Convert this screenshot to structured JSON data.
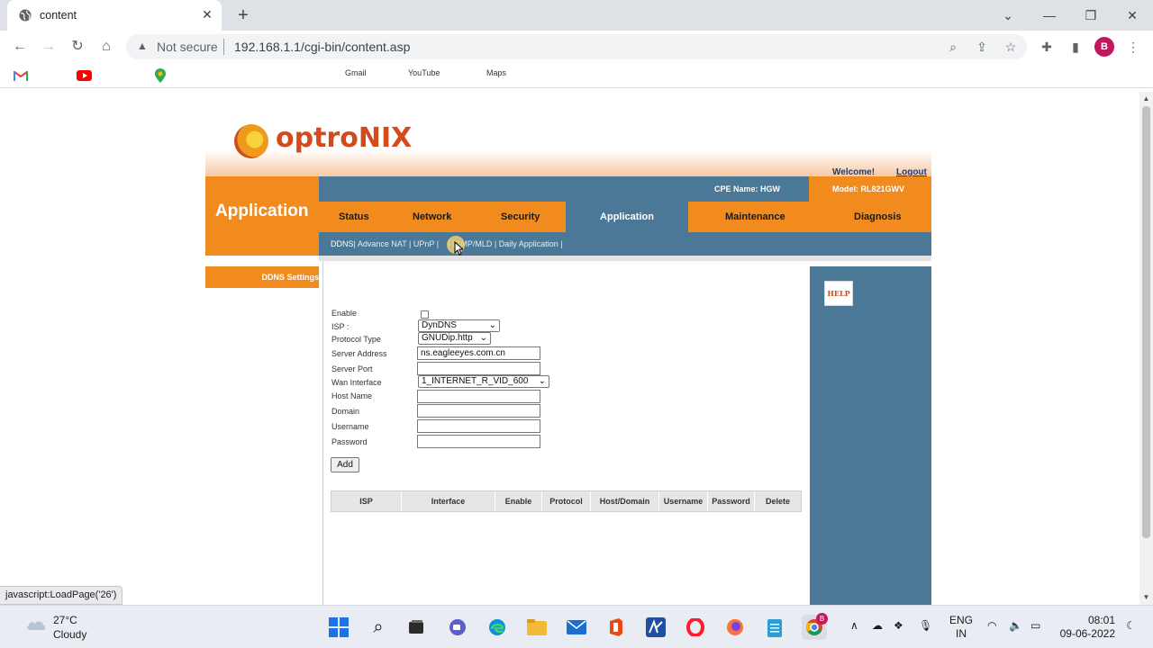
{
  "browser": {
    "tab_title": "content",
    "address": {
      "security_label": "Not secure",
      "url": "192.168.1.1/cgi-bin/content.asp"
    },
    "bookmarks": [
      {
        "label": "Gmail",
        "icon": "gmail-icon"
      },
      {
        "label": "YouTube",
        "icon": "youtube-icon"
      },
      {
        "label": "Maps",
        "icon": "maps-icon"
      }
    ],
    "profile_initial": "B",
    "status_url": "javascript:LoadPage('26')"
  },
  "router": {
    "brand": "optroNIX",
    "welcome": "Welcome!",
    "logout": "Logout",
    "section_title": "Application",
    "cpe_name": "CPE Name: HGW",
    "model": "Model: RL821GWV",
    "menu": [
      "Status",
      "Network",
      "Security",
      "Application",
      "Maintenance",
      "Diagnosis"
    ],
    "active_menu": "Application",
    "submenu": {
      "active": "DDNS",
      "rest": "| Advance NAT | UPnP |    | IGMP/MLD | Daily Application |"
    },
    "side_tab": "DDNS Settings",
    "help_label": "HELP",
    "form": {
      "enable_label": "Enable",
      "isp_label": "ISP :",
      "isp_value": "DynDNS",
      "protocol_label": "Protocol Type",
      "protocol_value": "GNUDip.http",
      "server_address_label": "Server Address",
      "server_address_value": "ns.eagleeyes.com.cn",
      "server_port_label": "Server Port",
      "server_port_value": "",
      "wan_label": "Wan Interface",
      "wan_value": "1_INTERNET_R_VID_600",
      "host_label": "Host Name",
      "host_value": "",
      "domain_label": "Domain",
      "domain_value": "",
      "username_label": "Username",
      "username_value": "",
      "password_label": "Password",
      "password_value": "",
      "add_button": "Add"
    },
    "table_headers": [
      "ISP",
      "Interface",
      "Enable",
      "Protocol",
      "Host/Domain",
      "Username",
      "Password",
      "Delete"
    ]
  },
  "taskbar": {
    "temperature": "27°C",
    "condition": "Cloudy",
    "language": [
      "ENG",
      "IN"
    ],
    "time": "08:01",
    "date": "09-06-2022",
    "chrome_badge": "B"
  },
  "colors": {
    "orange": "#f18b1e",
    "steel_blue": "#4a7896",
    "brand_red": "#d44a1b"
  }
}
